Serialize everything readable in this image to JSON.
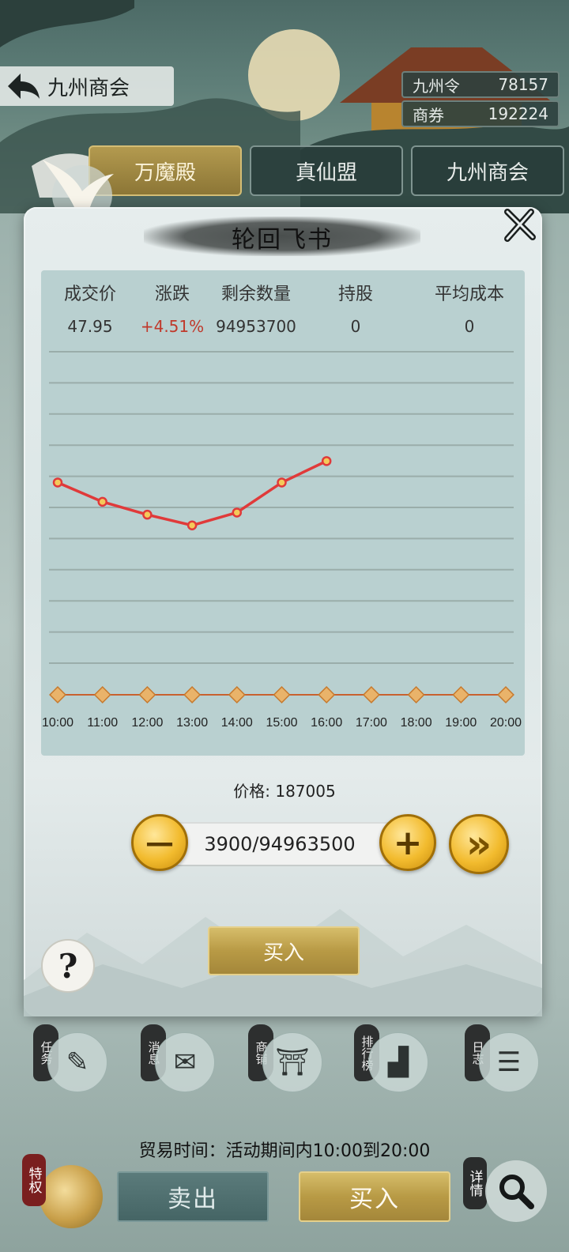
{
  "header": {
    "back_icon": "back-arrow-icon",
    "title": "九州商会",
    "resources": [
      {
        "label": "九州令",
        "value": "78157"
      },
      {
        "label": "商券",
        "value": "192224"
      }
    ]
  },
  "tabs": [
    {
      "label": "万魔殿",
      "active": true
    },
    {
      "label": "真仙盟",
      "active": false
    },
    {
      "label": "九州商会",
      "active": false
    }
  ],
  "modal": {
    "title": "轮回飞书",
    "close_icon": "close-icon",
    "stats_headers": [
      "成交价",
      "涨跌",
      "剩余数量",
      "持股",
      "平均成本"
    ],
    "stats_values": [
      "47.95",
      "+4.51%",
      "94953700",
      "0",
      "0"
    ],
    "change_color": "#c0392b",
    "price_label": "价格: 187005",
    "quantity_display": "3900/94963500",
    "minus_label": "—",
    "plus_label": "+",
    "max_label": "»",
    "buy_label": "买入",
    "help_label": "?"
  },
  "chart_data": {
    "type": "line",
    "x": [
      "10:00",
      "11:00",
      "12:00",
      "13:00",
      "14:00",
      "15:00",
      "16:00",
      "17:00",
      "18:00",
      "19:00",
      "20:00"
    ],
    "series": [
      {
        "values": [
          47.9,
          47.0,
          46.4,
          45.9,
          46.5,
          47.9,
          48.9,
          null,
          null,
          null,
          null
        ],
        "color": "#e03a3a"
      }
    ],
    "ylim": [
      38,
      54
    ],
    "grid": true,
    "baseline_color": "#c8612f",
    "marker_fill": "#f5c95a"
  },
  "bottom_nav": [
    {
      "tag": "任务",
      "icon": "quest-icon"
    },
    {
      "tag": "消息",
      "icon": "message-icon"
    },
    {
      "tag": "商铺",
      "icon": "shop-icon"
    },
    {
      "tag": "排行榜",
      "icon": "ranking-icon"
    },
    {
      "tag": "日志",
      "icon": "log-icon"
    }
  ],
  "footer": {
    "trade_time": "贸易时间：活动期间内10:00到20:00",
    "privilege_tag": "特权",
    "sell_label": "卖出",
    "buy_label": "买入",
    "detail_tag": "详情",
    "search_icon": "magnifier-icon"
  }
}
